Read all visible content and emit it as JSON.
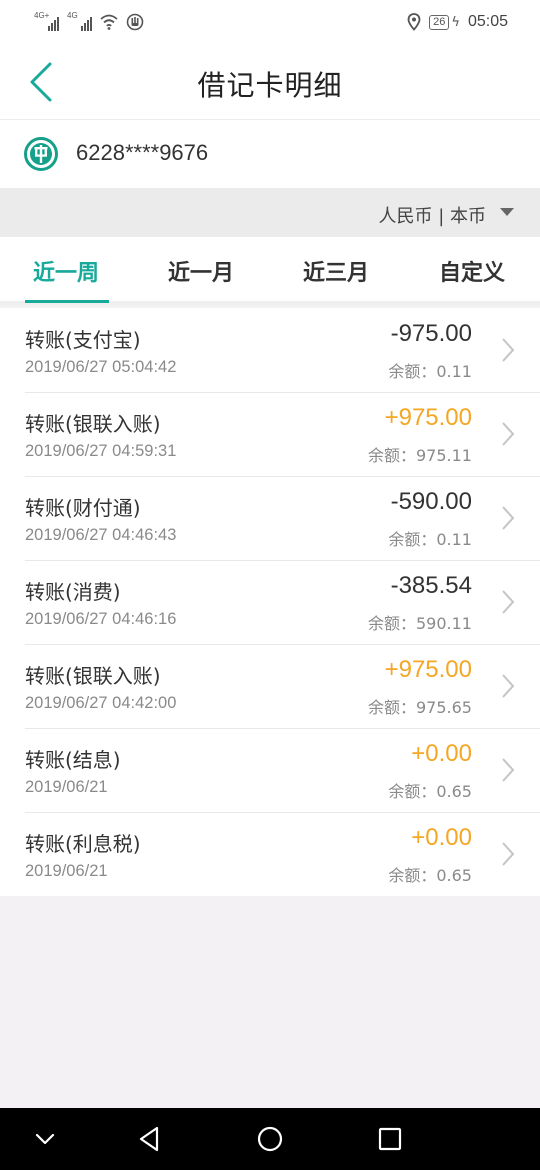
{
  "status_bar": {
    "signal1_tag": "4G+",
    "signal2_tag": "4G",
    "battery": "26",
    "time": "05:05"
  },
  "header": {
    "title": "借记卡明细"
  },
  "card": {
    "number": "6228****9676"
  },
  "currency": {
    "label": "人民币 | 本币"
  },
  "tabs": [
    {
      "label": "近一周"
    },
    {
      "label": "近一月"
    },
    {
      "label": "近三月"
    },
    {
      "label": "自定义"
    }
  ],
  "transactions": [
    {
      "title": "转账(支付宝)",
      "time": "2019/06/27 05:04:42",
      "amount": "-975.00",
      "balance": "余额：0.11"
    },
    {
      "title": "转账(银联入账)",
      "time": "2019/06/27 04:59:31",
      "amount": "+975.00",
      "balance": "余额：975.11"
    },
    {
      "title": "转账(财付通)",
      "time": "2019/06/27 04:46:43",
      "amount": "-590.00",
      "balance": "余额：0.11"
    },
    {
      "title": "转账(消费)",
      "time": "2019/06/27 04:46:16",
      "amount": "-385.54",
      "balance": "余额：590.11"
    },
    {
      "title": "转账(银联入账)",
      "time": "2019/06/27 04:42:00",
      "amount": "+975.00",
      "balance": "余额：975.65"
    },
    {
      "title": "转账(结息)",
      "time": "2019/06/21",
      "amount": "+0.00",
      "balance": "余额：0.65"
    },
    {
      "title": "转账(利息税)",
      "time": "2019/06/21",
      "amount": "+0.00",
      "balance": "余额：0.65"
    }
  ],
  "colors": {
    "accent": "#17a99a",
    "income": "#f5a623"
  }
}
